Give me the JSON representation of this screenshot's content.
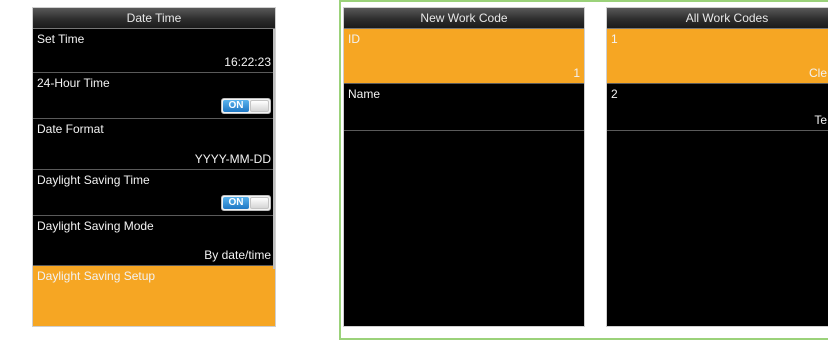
{
  "date_time": {
    "title": "Date Time",
    "rows": [
      {
        "label": "Set Time",
        "value": "16:22:23"
      },
      {
        "label": "24-Hour Time",
        "toggle": "ON"
      },
      {
        "label": "Date Format",
        "value": "YYYY-MM-DD"
      },
      {
        "label": "Daylight Saving Time",
        "toggle": "ON"
      },
      {
        "label": "Daylight Saving Mode",
        "value": "By date/time"
      },
      {
        "label": "Daylight Saving Setup"
      }
    ]
  },
  "new_work_code": {
    "title": "New Work Code",
    "rows": [
      {
        "label": "ID",
        "value": "1"
      },
      {
        "label": "Name",
        "value": ""
      }
    ]
  },
  "all_work_codes": {
    "title": "All Work Codes",
    "rows": [
      {
        "label": "1",
        "value": "Cle"
      },
      {
        "label": "2",
        "value": "Te"
      }
    ]
  },
  "colors": {
    "highlight": "#f6a623",
    "toggle_on": "#1f78c4",
    "frame": "#9bd27a",
    "screen_bg": "#000000"
  }
}
